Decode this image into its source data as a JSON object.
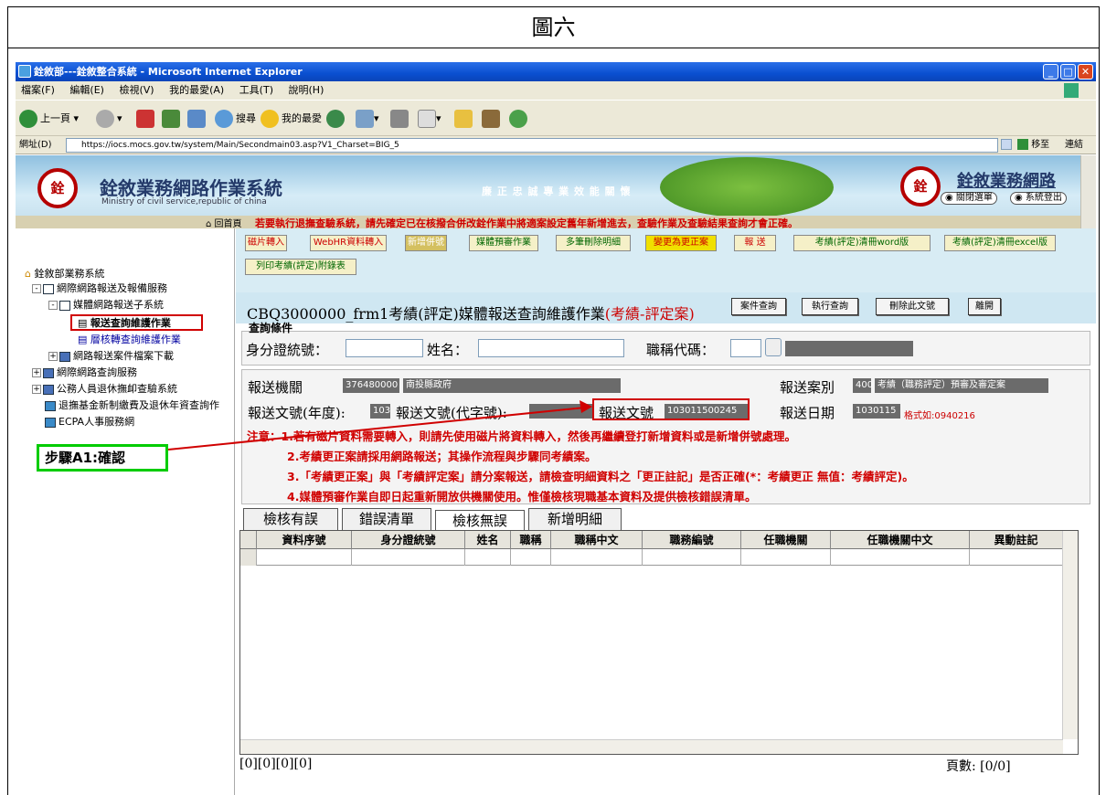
{
  "caption": "圖六",
  "window": {
    "title": "銓敘部---銓敘整合系統 - Microsoft Internet Explorer"
  },
  "menu": [
    "檔案(F)",
    "編輯(E)",
    "檢視(V)",
    "我的最愛(A)",
    "工具(T)",
    "說明(H)"
  ],
  "toolbar": {
    "back": "上一頁",
    "search": "搜尋",
    "favorites": "我的最愛",
    "go": "移至",
    "links": "連結"
  },
  "address": {
    "label": "網址(D)",
    "url": "https://iocs.mocs.gov.tw/system/Main/Secondmain03.asp?V1_Charset=BIG_5"
  },
  "banner": {
    "title": "銓敘業務網路作業系統",
    "subtitle": "Ministry of civil service,republic of china",
    "values": "廉 正  忠 誠  專 業  效 能  關 懷",
    "right_title": "銓敘業務網路",
    "btn_menu": "關閉選單",
    "btn_logout": "系統登出",
    "home": "回首頁",
    "marquee": "若要執行退撫查驗系統，請先確定已在核撥合併改銓作業中將適案設定舊年新增進去，查驗作業及查驗結果查詢才會正確。"
  },
  "nav": {
    "root": "銓敘部業務系統",
    "items": [
      "網際網路報送及報備服務",
      "媒體網路報送子系統",
      "報送查詢維護作業",
      "層核轉查詢維護作業",
      "網路報送案件檔案下載",
      "網際網路查詢服務",
      "公務人員退休撫卹查驗系統",
      "退撫基金新制繳費及退休年資查詢作",
      "ECPA人事服務網"
    ]
  },
  "step_label": "步驟A1:確認",
  "func_buttons": [
    "磁片轉入",
    "WebHR資料轉入",
    "新增併號",
    "媒體預審作業",
    "多筆刪除明細",
    "變更為更正案",
    "報 送",
    "考績(評定)清冊word版",
    "考績(評定)清冊excel版",
    "列印考績(評定)附錄表"
  ],
  "page": {
    "title": "CBQ3000000_frm1考績(評定)媒體報送查詢維護作業",
    "title_red": "(考績-評定案)",
    "btn_case": "案件查詢",
    "btn_query": "執行查詢",
    "btn_delete": "刪除此文號",
    "btn_leave": "離開"
  },
  "query": {
    "label": "查詢條件",
    "id": "身分證統號：",
    "name": "姓名：",
    "title_code": "職稱代碼："
  },
  "info": {
    "org_label": "報送機關",
    "org_code": "376480000",
    "org_name": "南投縣政府",
    "case_label": "報送案別",
    "case_code": "400",
    "case_name": "考績（職務評定）預審及審定案",
    "year_label": "報送文號(年度):",
    "year": "103",
    "char_label": "報送文號(代字號):",
    "num_label": "報送文號",
    "num": "103011500245",
    "date_label": "報送日期",
    "date": "1030115",
    "date_hint": "格式如:0940216"
  },
  "notes": [
    "注意：1.若有磁片資料需要轉入，則請先使用磁片將資料轉入，然後再繼續登打新增資料或是新增併號處理。",
    "2.考績更正案請採用網路報送；其操作流程與步驟同考績案。",
    "3.「考績更正案」與「考績評定案」請分案報送，請檢查明細資料之「更正註記」是否正確(*：考績更正 無值：考績評定)。",
    "4.媒體預審作業自即日起重新開放供機關使用。惟僅檢核現職基本資料及提供檢核錯誤清單。"
  ],
  "tabs": [
    "檢核有誤",
    "錯誤清單",
    "檢核無誤",
    "新增明細"
  ],
  "columns": [
    "資料序號",
    "身分證統號",
    "姓名",
    "職稱",
    "職稱中文",
    "職務編號",
    "任職機關",
    "任職機關中文",
    "異動註記"
  ],
  "status": {
    "left": "[0][0][0][0]",
    "right": "頁數: [0/0]"
  },
  "colors": {
    "accent_red": "#d00000",
    "step_green": "#00cc00",
    "banner": "#8fc0e0"
  }
}
